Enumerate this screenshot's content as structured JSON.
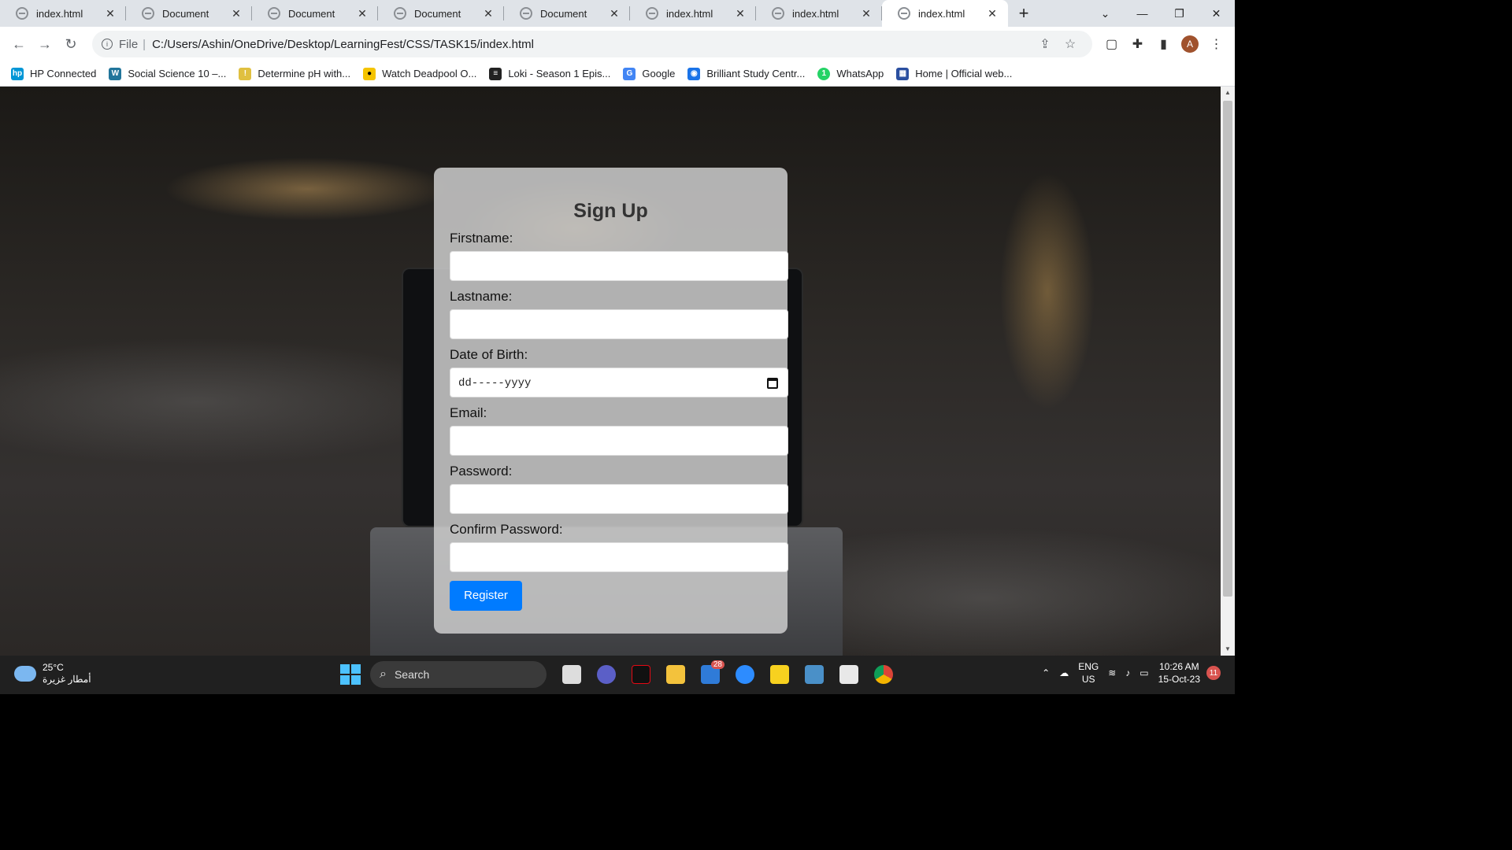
{
  "tabs": [
    {
      "title": "index.html"
    },
    {
      "title": "Document"
    },
    {
      "title": "Document"
    },
    {
      "title": "Document"
    },
    {
      "title": "Document"
    },
    {
      "title": "index.html"
    },
    {
      "title": "index.html"
    },
    {
      "title": "index.html",
      "active": true
    }
  ],
  "window": {
    "minimize": "—",
    "maximize": "❐",
    "close": "✕",
    "tabsearch": "⌄"
  },
  "toolbar": {
    "back": "←",
    "forward": "→",
    "reload": "↻",
    "scheme": "File",
    "url": "C:/Users/Ashin/OneDrive/Desktop/LearningFest/CSS/TASK15/index.html",
    "avatar": "A"
  },
  "bookmarks": [
    {
      "label": "HP Connected",
      "color": "#0096d6",
      "glyph": "hp"
    },
    {
      "label": "Social Science 10 –...",
      "color": "#21759b",
      "glyph": "W"
    },
    {
      "label": "Determine pH with...",
      "color": "#e0c040",
      "glyph": "!"
    },
    {
      "label": "Watch Deadpool O...",
      "color": "#f5c400",
      "glyph": "●"
    },
    {
      "label": "Loki - Season 1 Epis...",
      "color": "#222222",
      "glyph": "≡"
    },
    {
      "label": "Google",
      "color": "#4285f4",
      "glyph": "G"
    },
    {
      "label": "Brilliant Study Centr...",
      "color": "#1a73e8",
      "glyph": "◉"
    },
    {
      "label": "WhatsApp",
      "color": "#25d366",
      "glyph": "1"
    },
    {
      "label": "Home | Official web...",
      "color": "#2a4fa0",
      "glyph": "▦"
    }
  ],
  "form": {
    "title": "Sign Up",
    "fields": [
      {
        "label": "Firstname:",
        "value": ""
      },
      {
        "label": "Lastname:",
        "value": ""
      },
      {
        "label": "Date of Birth:",
        "value": "dd-----yyyy"
      },
      {
        "label": "Email:",
        "value": ""
      },
      {
        "label": "Password:",
        "value": ""
      },
      {
        "label": "Confirm Password:",
        "value": ""
      }
    ],
    "submit": "Register",
    "accent": "#007bff"
  },
  "taskbar": {
    "temp": "25°C",
    "weather_desc": "أمطار غزيرة",
    "search": "Search",
    "mail_badge": "28",
    "lang": "ENG",
    "region": "US",
    "time": "10:26 AM",
    "date": "15-Oct-23",
    "notifications": "11"
  }
}
